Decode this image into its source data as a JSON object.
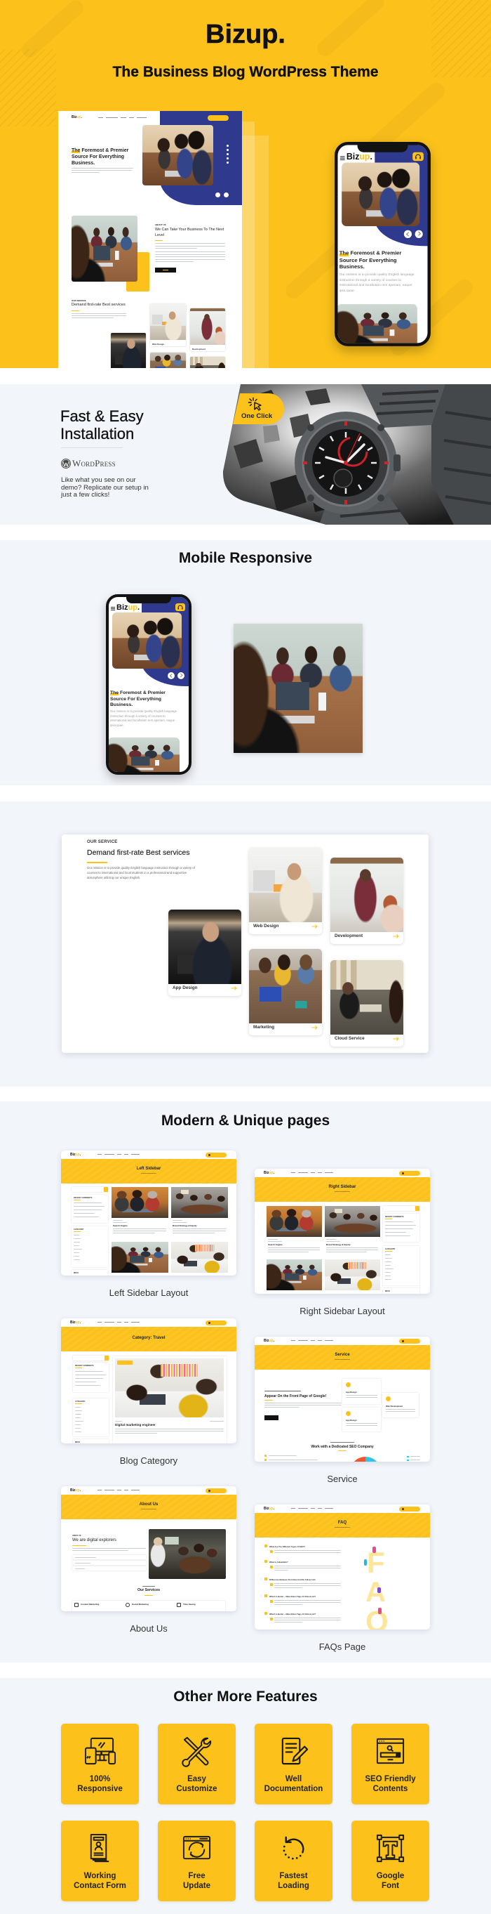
{
  "brand": {
    "logo_main": "Biz",
    "logo_accent": "up",
    "logo_dot": "."
  },
  "hero": {
    "title": "Bizup.",
    "subtitle": "The Business Blog WordPress Theme"
  },
  "desktop_preview": {
    "heading_highlight": "The",
    "heading_rest": " Foremost & Premier Source For Everything Business.",
    "about_eyebrow": "ABOUT US",
    "about_heading": "We Can Take Your Business To The Next Level",
    "services_eyebrow": "OUR SERVICE",
    "services_heading": "Demand first-rate Best services",
    "service_cards": [
      "Web Design",
      "Development"
    ]
  },
  "phone_preview": {
    "heading_highlight": "The",
    "heading_rest": " Foremost & Premier Source For Everything Business.",
    "paragraph": "Our mission is to provide quality English language instruction through a variety of courses to international and localtotam rem aperiam, eaque ipsa quae."
  },
  "installation": {
    "title_line1": "Fast & Easy",
    "title_line2": "Installation",
    "platform_logo_text": "WordPress",
    "description": "Like what you see on our demo? Replicate our setup in just a few clicks!",
    "badge_label": "One Click"
  },
  "mobile_section": {
    "title": "Mobile Responsive"
  },
  "services_section": {
    "eyebrow": "OUR SERVICE",
    "title": "Demand first-rate Best services",
    "description": "Our mission is to provide quality English language instruction through a variety of courses to international and local students in a professional and supportive atmosphere utilizing our unique English.",
    "cards": [
      {
        "label": "App Design"
      },
      {
        "label": "Web Design"
      },
      {
        "label": "Development"
      },
      {
        "label": "Marketing"
      },
      {
        "label": "Cloud Service"
      }
    ]
  },
  "pages_section": {
    "title": "Modern & Unique pages",
    "pages": [
      {
        "caption": "Left Sidebar Layout",
        "banner_title": "Left Sidebar",
        "posts": [
          "Search Engine",
          "Brand Strategy & Equity"
        ],
        "widgets": [
          "RECENT COMMENTS",
          "CATEGORY",
          "META"
        ]
      },
      {
        "caption": "Right Sidebar Layout",
        "banner_title": "Right Sidebar",
        "posts": [
          "Search Engine",
          "Brand Strategy & Equity"
        ],
        "widgets": [
          "RECENT COMMENTS",
          "CATEGORY",
          "META"
        ]
      },
      {
        "caption": "Blog Category",
        "banner_title": "Category: Travel",
        "post_title": "Digital marketing engineer",
        "widgets": [
          "RECENT COMMENTS",
          "CATEGORY",
          "META"
        ]
      },
      {
        "caption": "Service",
        "banner_title": "Service",
        "heading": "Appear On the Front Page of Google!",
        "service_cards": [
          "App Design",
          "App Design",
          "Web Development"
        ],
        "section_heading": "Work with a Dedicated SEO Company"
      },
      {
        "caption": "About Us",
        "banner_title": "About Us",
        "eyebrow": "ABOUT US",
        "heading": "We are digital explorers",
        "services_heading": "Our Services",
        "services": [
          "Content Marketing",
          "Social Marketing",
          "Time Saving"
        ]
      },
      {
        "caption": "FAQs Page",
        "banner_title": "FAQ",
        "questions": [
          "What Are The Different Types Of SEO?",
          "What Is A Backlink?",
          "Difference Between Do-follow And No-follow Link",
          "Which Is Better – Meta Robot Tags Or Robots.txt?",
          "Which Is Better – Meta Robot Tags Or Robots.txt?"
        ],
        "illustration_letters": [
          "F",
          "A",
          "Q"
        ]
      }
    ]
  },
  "features_section": {
    "title": "Other More Features",
    "items": [
      {
        "line1": "100%",
        "line2": "Responsive",
        "icon": "devices-icon"
      },
      {
        "line1": "Easy",
        "line2": "Customize",
        "icon": "tools-icon"
      },
      {
        "line1": "Well",
        "line2": "Documentation",
        "icon": "document-edit-icon"
      },
      {
        "line1": "SEO Friendly",
        "line2": "Contents",
        "icon": "seo-search-icon"
      },
      {
        "line1": "Working",
        "line2": "Contact Form",
        "icon": "contact-form-icon"
      },
      {
        "line1": "Free",
        "line2": "Update",
        "icon": "update-icon"
      },
      {
        "line1": "Fastest",
        "line2": "Loading",
        "icon": "loading-icon"
      },
      {
        "line1": "Google",
        "line2": "Font",
        "icon": "font-icon"
      }
    ]
  },
  "colors": {
    "brand_yellow": "#fcc21b",
    "navy": "#2f3a8f",
    "light_background": "#f2f5fa",
    "text_dark": "#111111"
  }
}
